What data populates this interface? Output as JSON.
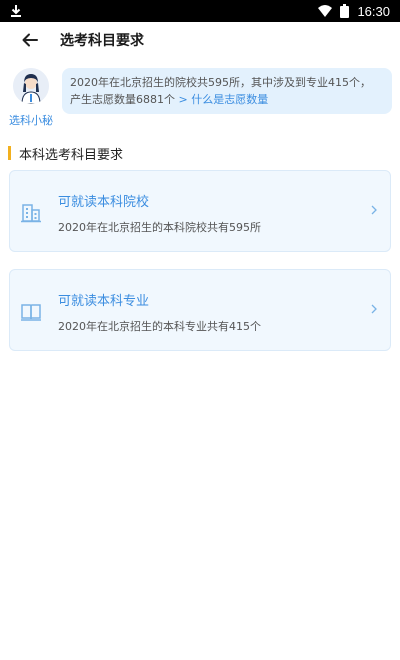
{
  "status_bar": {
    "time": "16:30"
  },
  "header": {
    "title": "选考科目要求"
  },
  "assistant": {
    "name": "选科小秘",
    "message_line1": "2020年在北京招生的院校共595所，其中涉及到专业415个，",
    "message_line2": "产生志愿数量6881个",
    "link_text": "> 什么是志愿数量"
  },
  "section": {
    "title": "本科选考科目要求"
  },
  "cards": [
    {
      "title": "可就读本科院校",
      "subtitle": "2020年在北京招生的本科院校共有595所",
      "icon": "building-icon"
    },
    {
      "title": "可就读本科专业",
      "subtitle": "2020年在北京招生的本科专业共有415个",
      "icon": "book-icon"
    }
  ],
  "colors": {
    "accent": "#3b8de0",
    "bubble_bg": "#e3f1fd",
    "card_bg": "#f1f8fe",
    "section_bar": "#f2b01e"
  }
}
